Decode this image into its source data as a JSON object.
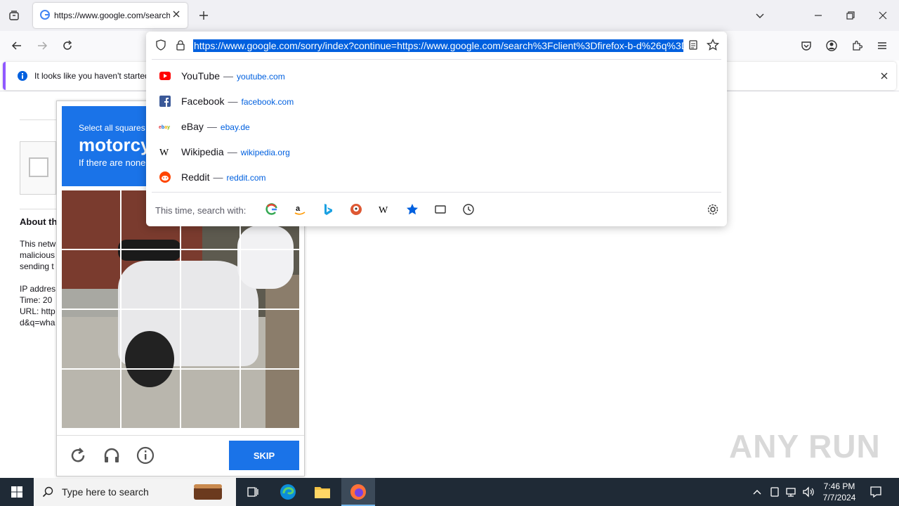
{
  "browser": {
    "tab_title": "https://www.google.com/search",
    "url": "https://www.google.com/sorry/index?continue=https://www.google.com/search%3Fclient%3Dfirefox-b-d%26q%3D",
    "notification": "It looks like you haven't started"
  },
  "suggestions": [
    {
      "title": "YouTube",
      "url": "youtube.com",
      "icon": "youtube-icon",
      "color": "#ff0000"
    },
    {
      "title": "Facebook",
      "url": "facebook.com",
      "icon": "facebook-icon",
      "color": "#3b5998"
    },
    {
      "title": "eBay",
      "url": "ebay.de",
      "icon": "ebay-icon",
      "color": "#e53238"
    },
    {
      "title": "Wikipedia",
      "url": "wikipedia.org",
      "icon": "wikipedia-icon",
      "color": "#000000"
    },
    {
      "title": "Reddit",
      "url": "reddit.com",
      "icon": "reddit-icon",
      "color": "#ff4500"
    }
  ],
  "search_with_label": "This time, search with:",
  "page": {
    "about": "About th",
    "lines": [
      "This netw",
      "malicious",
      "sending t",
      "",
      "IP addres",
      "Time: 20",
      "URL: http",
      "d&q=wha"
    ]
  },
  "captcha": {
    "instruction": "Select all squares",
    "object": "motorcy",
    "hint": "If there are none",
    "skip": "SKIP"
  },
  "taskbar": {
    "search_placeholder": "Type here to search",
    "time": "7:46 PM",
    "date": "7/7/2024"
  },
  "watermark": "ANY RUN"
}
